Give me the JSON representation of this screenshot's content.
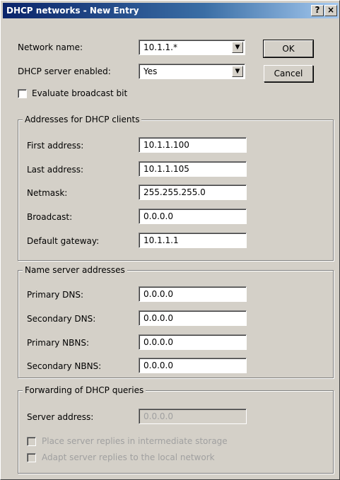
{
  "window": {
    "title": "DHCP networks - New Entry",
    "help_label": "?",
    "close_label": "×"
  },
  "form": {
    "network_name_label": "Network name:",
    "network_name_value": "10.1.1.*",
    "dhcp_enabled_label": "DHCP server enabled:",
    "dhcp_enabled_value": "Yes",
    "evaluate_broadcast_label": "Evaluate broadcast bit"
  },
  "buttons": {
    "ok": "OK",
    "cancel": "Cancel"
  },
  "clients_group": {
    "title": "Addresses for DHCP clients",
    "first_label": "First address:",
    "first_value": "10.1.1.100",
    "last_label": "Last address:",
    "last_value": "10.1.1.105",
    "netmask_label": "Netmask:",
    "netmask_value": "255.255.255.0",
    "broadcast_label": "Broadcast:",
    "broadcast_value": "0.0.0.0",
    "gateway_label": "Default gateway:",
    "gateway_value": "10.1.1.1"
  },
  "ns_group": {
    "title": "Name server addresses",
    "pdns_label": "Primary DNS:",
    "pdns_value": "0.0.0.0",
    "sdns_label": "Secondary DNS:",
    "sdns_value": "0.0.0.0",
    "pnbns_label": "Primary NBNS:",
    "pnbns_value": "0.0.0.0",
    "snbns_label": "Secondary NBNS:",
    "snbns_value": "0.0.0.0"
  },
  "fwd_group": {
    "title": "Forwarding of DHCP queries",
    "server_label": "Server address:",
    "server_value": "0.0.0.0",
    "store_label": "Place server replies in intermediate storage",
    "adapt_label": "Adapt server replies to the local network"
  },
  "icons": {
    "combo_arrow": "▼"
  }
}
